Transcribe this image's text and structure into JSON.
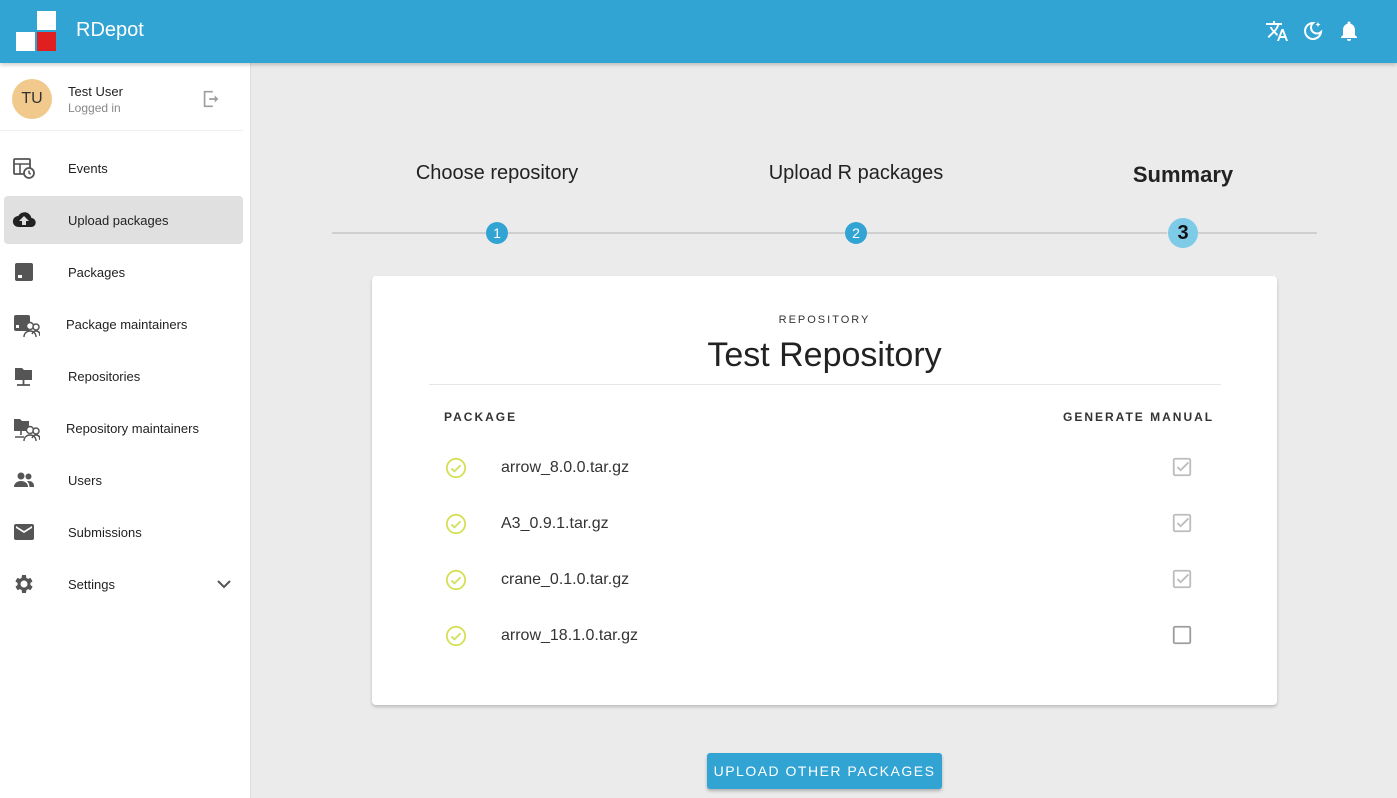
{
  "app": {
    "title": "RDepot",
    "brand_colors": {
      "primary": "#32a4d4",
      "logo_red": "#e02020",
      "logo_blue": "#32a4d4"
    },
    "top_icons": [
      "translate-icon",
      "dark-mode-icon",
      "bell-icon"
    ]
  },
  "user": {
    "initials": "TU",
    "name": "Test User",
    "status": "Logged in"
  },
  "sidebar": {
    "items": [
      {
        "label": "Events",
        "icon": "events-icon"
      },
      {
        "label": "Upload packages",
        "icon": "cloud-upload-icon",
        "active": true
      },
      {
        "label": "Packages",
        "icon": "package-icon"
      },
      {
        "label": "Package maintainers",
        "icon": "package-maintainers-icon"
      },
      {
        "label": "Repositories",
        "icon": "repository-icon"
      },
      {
        "label": "Repository maintainers",
        "icon": "repository-maintainers-icon"
      },
      {
        "label": "Users",
        "icon": "users-icon"
      },
      {
        "label": "Submissions",
        "icon": "mail-icon"
      },
      {
        "label": "Settings",
        "icon": "gear-icon",
        "expandable": true
      }
    ]
  },
  "stepper": {
    "steps": [
      {
        "label": "Choose repository",
        "number": "1"
      },
      {
        "label": "Upload R packages",
        "number": "2"
      },
      {
        "label": "Summary",
        "number": "3",
        "active": true
      }
    ]
  },
  "summary": {
    "caption": "REPOSITORY",
    "repository": "Test Repository",
    "col_package": "PACKAGE",
    "col_manual": "GENERATE MANUAL",
    "packages": [
      {
        "name": "arrow_8.0.0.tar.gz",
        "generate_manual": true
      },
      {
        "name": "A3_0.9.1.tar.gz",
        "generate_manual": true
      },
      {
        "name": "crane_0.1.0.tar.gz",
        "generate_manual": true
      },
      {
        "name": "arrow_18.1.0.tar.gz",
        "generate_manual": false
      }
    ]
  },
  "actions": {
    "upload_other": "UPLOAD OTHER PACKAGES"
  }
}
